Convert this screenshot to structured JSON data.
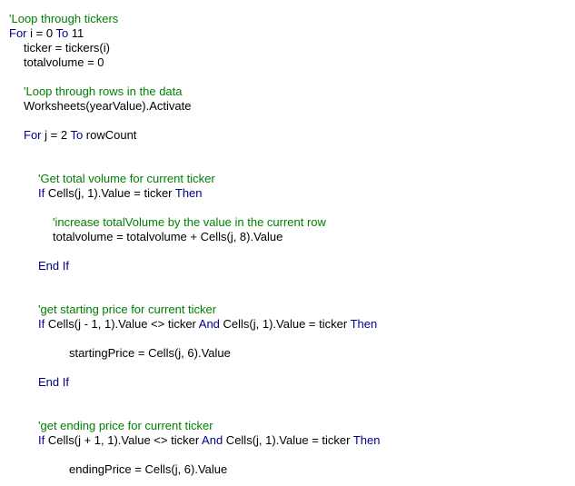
{
  "editor": {
    "colors": {
      "comment": "#008000",
      "keyword": "#00008b",
      "text": "#000000",
      "background": "#ffffff"
    },
    "lines": [
      {
        "indent": 0,
        "tokens": [
          {
            "k": "comment",
            "t": "'Loop through tickers"
          }
        ]
      },
      {
        "indent": 0,
        "tokens": [
          {
            "k": "keyword",
            "t": "For"
          },
          {
            "k": "text",
            "t": " i = 0 "
          },
          {
            "k": "keyword",
            "t": "To"
          },
          {
            "k": "text",
            "t": " 11"
          }
        ]
      },
      {
        "indent": 1,
        "tokens": [
          {
            "k": "text",
            "t": "ticker = tickers(i)"
          }
        ]
      },
      {
        "indent": 1,
        "tokens": [
          {
            "k": "text",
            "t": "totalvolume = 0"
          }
        ]
      },
      {
        "indent": 0,
        "tokens": []
      },
      {
        "indent": 1,
        "tokens": [
          {
            "k": "comment",
            "t": "'Loop through rows in the data"
          }
        ]
      },
      {
        "indent": 1,
        "tokens": [
          {
            "k": "text",
            "t": "Worksheets(yearValue).Activate"
          }
        ]
      },
      {
        "indent": 0,
        "tokens": []
      },
      {
        "indent": 1,
        "tokens": [
          {
            "k": "keyword",
            "t": "For"
          },
          {
            "k": "text",
            "t": " j = 2 "
          },
          {
            "k": "keyword",
            "t": "To"
          },
          {
            "k": "text",
            "t": " rowCount"
          }
        ]
      },
      {
        "indent": 0,
        "tokens": []
      },
      {
        "indent": 0,
        "tokens": []
      },
      {
        "indent": 2,
        "tokens": [
          {
            "k": "comment",
            "t": "'Get total volume for current ticker"
          }
        ]
      },
      {
        "indent": 2,
        "tokens": [
          {
            "k": "keyword",
            "t": "If"
          },
          {
            "k": "text",
            "t": " Cells(j, 1).Value = ticker "
          },
          {
            "k": "keyword",
            "t": "Then"
          }
        ]
      },
      {
        "indent": 0,
        "tokens": []
      },
      {
        "indent": 3,
        "tokens": [
          {
            "k": "comment",
            "t": "'increase totalVolume by the value in the current row"
          }
        ]
      },
      {
        "indent": 3,
        "tokens": [
          {
            "k": "text",
            "t": "totalvolume = totalvolume + Cells(j, 8).Value"
          }
        ]
      },
      {
        "indent": 0,
        "tokens": []
      },
      {
        "indent": 2,
        "tokens": [
          {
            "k": "keyword",
            "t": "End If"
          }
        ]
      },
      {
        "indent": 0,
        "tokens": []
      },
      {
        "indent": 0,
        "tokens": []
      },
      {
        "indent": 2,
        "tokens": [
          {
            "k": "comment",
            "t": "'get starting price for current ticker"
          }
        ]
      },
      {
        "indent": 2,
        "tokens": [
          {
            "k": "keyword",
            "t": "If"
          },
          {
            "k": "text",
            "t": " Cells(j - 1, 1).Value <> ticker "
          },
          {
            "k": "keyword",
            "t": "And"
          },
          {
            "k": "text",
            "t": " Cells(j, 1).Value = ticker "
          },
          {
            "k": "keyword",
            "t": "Then"
          }
        ]
      },
      {
        "indent": 0,
        "tokens": []
      },
      {
        "indent": 4,
        "tokens": [
          {
            "k": "text",
            "t": "startingPrice = Cells(j, 6).Value"
          }
        ]
      },
      {
        "indent": 0,
        "tokens": []
      },
      {
        "indent": 2,
        "tokens": [
          {
            "k": "keyword",
            "t": "End If"
          }
        ]
      },
      {
        "indent": 0,
        "tokens": []
      },
      {
        "indent": 0,
        "tokens": []
      },
      {
        "indent": 2,
        "tokens": [
          {
            "k": "comment",
            "t": "'get ending price for current ticker"
          }
        ]
      },
      {
        "indent": 2,
        "tokens": [
          {
            "k": "keyword",
            "t": "If"
          },
          {
            "k": "text",
            "t": " Cells(j + 1, 1).Value <> ticker "
          },
          {
            "k": "keyword",
            "t": "And"
          },
          {
            "k": "text",
            "t": " Cells(j, 1).Value = ticker "
          },
          {
            "k": "keyword",
            "t": "Then"
          }
        ]
      },
      {
        "indent": 0,
        "tokens": []
      },
      {
        "indent": 4,
        "tokens": [
          {
            "k": "text",
            "t": "endingPrice = Cells(j, 6).Value"
          }
        ]
      }
    ]
  }
}
